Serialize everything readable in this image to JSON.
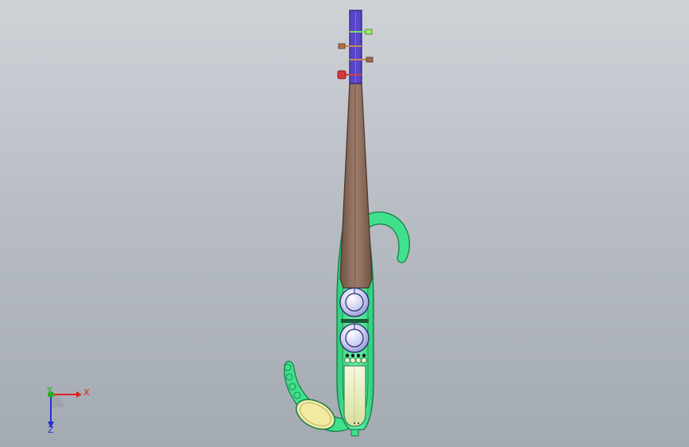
{
  "viewport": {
    "background_top": "#cfd3d8",
    "background_bottom": "#a4aab2"
  },
  "model": {
    "colors": {
      "body": "#40e08c",
      "body_edge": "#137a45",
      "neck": "#8a6a5a",
      "pegbox": "#5a46c8",
      "knob": "#c9ccf2",
      "chin_rest": "#f1eba2",
      "lower_panel": "#eef1c8"
    },
    "pegs": [
      "green-peg",
      "brown-peg",
      "brown-peg",
      "red-peg"
    ]
  },
  "triad": {
    "x_label": "X",
    "y_label": "Y",
    "z_label": "Z",
    "colors": {
      "x": "#e22020",
      "y": "#20b020",
      "z": "#2030d0"
    }
  }
}
